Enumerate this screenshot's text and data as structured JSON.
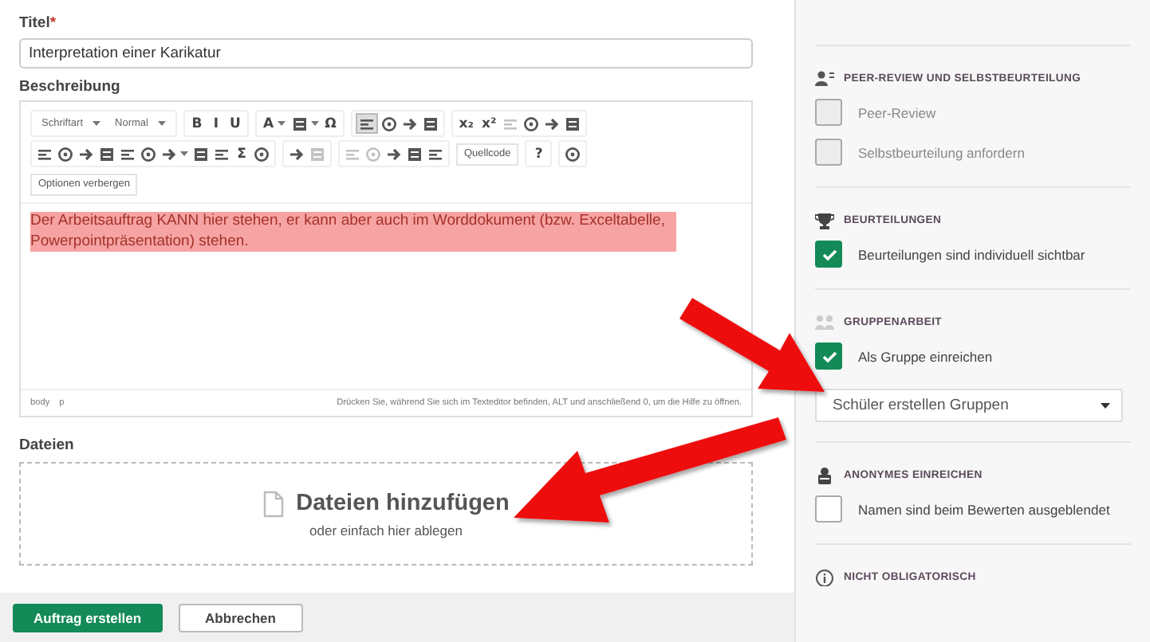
{
  "form": {
    "title_label": "Titel",
    "required_mark": "*",
    "title_value": "Interpretation einer Karikatur",
    "description_label": "Beschreibung",
    "editor": {
      "toolbar_rows": [
        [
          [
            {
              "kind": "select",
              "label": "Schriftart"
            },
            {
              "kind": "select",
              "label": "Normal"
            }
          ],
          [
            {
              "kind": "glyph",
              "label": "B"
            },
            {
              "kind": "glyph",
              "label": "I"
            },
            {
              "kind": "glyph",
              "label": "U"
            }
          ],
          [
            {
              "kind": "glyph_menu",
              "label": "A"
            },
            {
              "kind": "icon_menu",
              "active": false,
              "disabled": false
            },
            {
              "kind": "glyph",
              "label": "Ω"
            }
          ],
          [
            {
              "kind": "icon",
              "active": true,
              "disabled": false
            },
            {
              "kind": "icon",
              "active": false,
              "disabled": false
            },
            {
              "kind": "icon",
              "active": false,
              "disabled": false
            },
            {
              "kind": "icon",
              "active": false,
              "disabled": false
            }
          ],
          [
            {
              "kind": "glyph",
              "label": "x₂"
            },
            {
              "kind": "glyph",
              "label": "x²"
            },
            {
              "kind": "icon",
              "active": false,
              "disabled": true
            },
            {
              "kind": "icon",
              "active": false,
              "disabled": false
            },
            {
              "kind": "icon",
              "active": false,
              "disabled": false
            },
            {
              "kind": "icon",
              "active": false,
              "disabled": false
            }
          ]
        ],
        [
          [
            {
              "kind": "icon",
              "active": false,
              "disabled": false
            },
            {
              "kind": "icon",
              "active": false,
              "disabled": false
            },
            {
              "kind": "icon",
              "active": false,
              "disabled": false
            },
            {
              "kind": "icon",
              "active": false,
              "disabled": false
            },
            {
              "kind": "icon",
              "active": false,
              "disabled": false
            },
            {
              "kind": "icon",
              "active": false,
              "disabled": false
            },
            {
              "kind": "icon_menu",
              "active": false,
              "disabled": false
            },
            {
              "kind": "icon",
              "active": false,
              "disabled": false
            },
            {
              "kind": "icon",
              "active": false,
              "disabled": false
            },
            {
              "kind": "glyph",
              "label": "Σ"
            },
            {
              "kind": "icon",
              "active": false,
              "disabled": false
            }
          ],
          [
            {
              "kind": "icon",
              "active": false,
              "disabled": false
            },
            {
              "kind": "icon",
              "active": false,
              "disabled": true
            }
          ],
          [
            {
              "kind": "icon",
              "active": false,
              "disabled": true
            },
            {
              "kind": "icon",
              "active": false,
              "disabled": true
            },
            {
              "kind": "icon",
              "active": false,
              "disabled": false
            },
            {
              "kind": "icon",
              "active": false,
              "disabled": false
            },
            {
              "kind": "icon",
              "active": false,
              "disabled": false
            }
          ],
          [
            {
              "kind": "button",
              "label": "Quellcode"
            }
          ],
          [
            {
              "kind": "glyph",
              "label": "?"
            }
          ],
          [
            {
              "kind": "icon",
              "active": false,
              "disabled": false
            }
          ]
        ],
        [
          [
            {
              "kind": "button",
              "label": "Optionen verbergen"
            }
          ]
        ]
      ],
      "content": "Der Arbeitsauftrag KANN hier stehen, er kann aber auch im Worddokument (bzw. Exceltabelle, Powerpointpräsentation) stehen.",
      "content_highlighted": true,
      "path": [
        "body",
        "p"
      ],
      "help_text": "Drücken Sie, während Sie sich im Texteditor befinden, ALT und anschließend 0, um die Hilfe zu öffnen."
    },
    "files_label": "Dateien",
    "dropzone": {
      "title": "Dateien hinzufügen",
      "hint": "oder einfach hier ablegen"
    }
  },
  "buttons": [
    {
      "label": "Auftrag erstellen",
      "kind": "primary"
    },
    {
      "label": "Abbrechen",
      "kind": "secondary"
    }
  ],
  "sidebar": {
    "sections": [
      {
        "heading": "PEER-REVIEW UND SELBSTBEURTEILUNG",
        "options": [
          {
            "kind": "checkbox",
            "label": "Peer-Review",
            "checked": false,
            "disabled": true
          },
          {
            "kind": "checkbox",
            "label": "Selbstbeurteilung anfordern",
            "checked": false,
            "disabled": true
          }
        ]
      },
      {
        "heading": "BEURTEILUNGEN",
        "options": [
          {
            "kind": "checkbox",
            "label": "Beurteilungen sind individuell sichtbar",
            "checked": true,
            "disabled": false
          }
        ]
      },
      {
        "heading": "GRUPPENARBEIT",
        "options": [
          {
            "kind": "checkbox",
            "label": "Als Gruppe einreichen",
            "checked": true,
            "disabled": false
          },
          {
            "kind": "select",
            "value": "Schüler erstellen Gruppen"
          }
        ]
      },
      {
        "heading": "ANONYMES EINREICHEN",
        "options": [
          {
            "kind": "checkbox",
            "label": "Namen sind beim Bewerten ausgeblendet",
            "checked": false,
            "disabled": false
          }
        ]
      },
      {
        "heading": "NICHT OBLIGATORISCH"
      }
    ]
  }
}
